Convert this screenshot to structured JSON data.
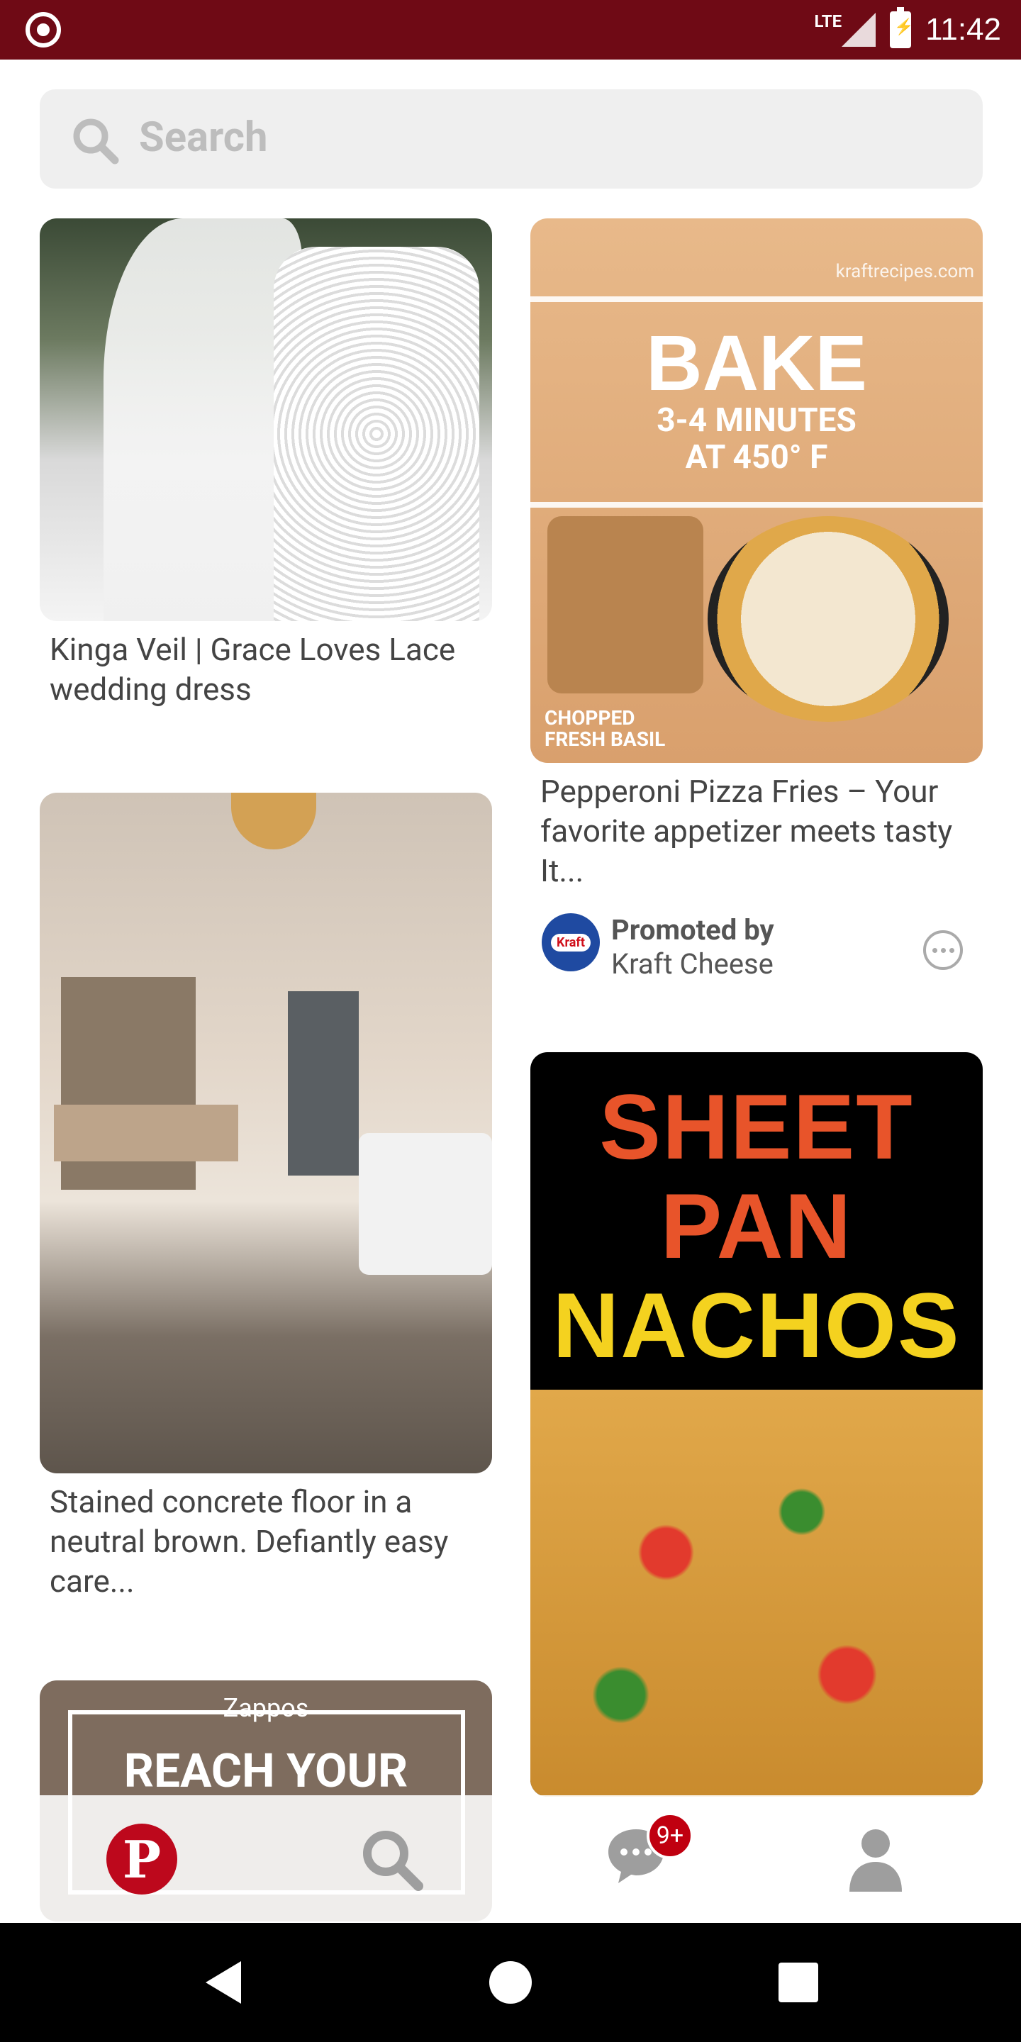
{
  "status_bar": {
    "network": "LTE",
    "time": "11:42"
  },
  "search": {
    "placeholder": "Search"
  },
  "pins": [
    {
      "caption": "Kinga Veil | Grace Loves Lace wedding dress"
    },
    {
      "caption": "Pepperoni Pizza Fries – Your favorite appetizer meets tasty It...",
      "image_text": {
        "site": "kraftrecipes.com",
        "headline": "BAKE",
        "line1": "3-4 MINUTES",
        "line2": "AT 450° F",
        "chopped1": "CHOPPED",
        "chopped2": "FRESH BASIL"
      },
      "promoted_label": "Promoted by",
      "promoted_brand": "Kraft Cheese",
      "avatar_text": "Kraft"
    },
    {
      "caption": "Stained concrete floor in a neutral brown. Defiantly easy care..."
    },
    {
      "image_text": {
        "line1": "SHEET",
        "line2": "PAN",
        "line3": "NACHOS"
      }
    },
    {
      "image_text": {
        "brand": "Zappos",
        "line1": "REACH YOUR"
      }
    }
  ],
  "bottom_nav": {
    "home_glyph": "P",
    "notifications_badge": "9+"
  },
  "colors": {
    "status_bar": "#6f0a15",
    "brand_red": "#bd081c",
    "nacho_orange": "#e8542a",
    "nacho_yellow": "#f4d21f"
  }
}
